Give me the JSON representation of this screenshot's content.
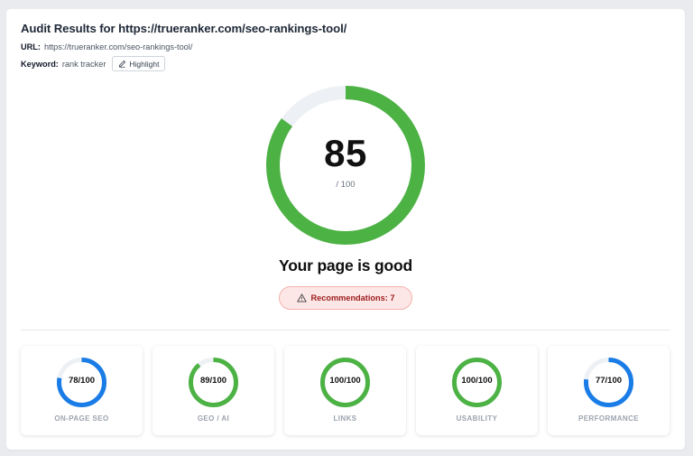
{
  "header": {
    "title": "Audit Results for https://trueranker.com/seo-rankings-tool/",
    "url_label": "URL:",
    "url_value": "https://trueranker.com/seo-rankings-tool/",
    "keyword_label": "Keyword:",
    "keyword_value": "rank tracker",
    "highlight_button": "Highlight"
  },
  "score": {
    "value": "85",
    "max_text": "/ 100",
    "fraction": 0.85,
    "color": "#4cb244",
    "track_color": "#edf0f4",
    "status_text": "Your page is good"
  },
  "recommendations": {
    "label": "Recommendations: 7"
  },
  "categories": [
    {
      "label": "ON-PAGE SEO",
      "score": "78/100",
      "fraction": 0.78,
      "color": "#1a7ce6"
    },
    {
      "label": "GEO / AI",
      "score": "89/100",
      "fraction": 0.89,
      "color": "#4cb244"
    },
    {
      "label": "LINKS",
      "score": "100/100",
      "fraction": 1.0,
      "color": "#4cb244"
    },
    {
      "label": "USABILITY",
      "score": "100/100",
      "fraction": 1.0,
      "color": "#4cb244"
    },
    {
      "label": "PERFORMANCE",
      "score": "77/100",
      "fraction": 0.77,
      "color": "#1a7ce6"
    }
  ]
}
